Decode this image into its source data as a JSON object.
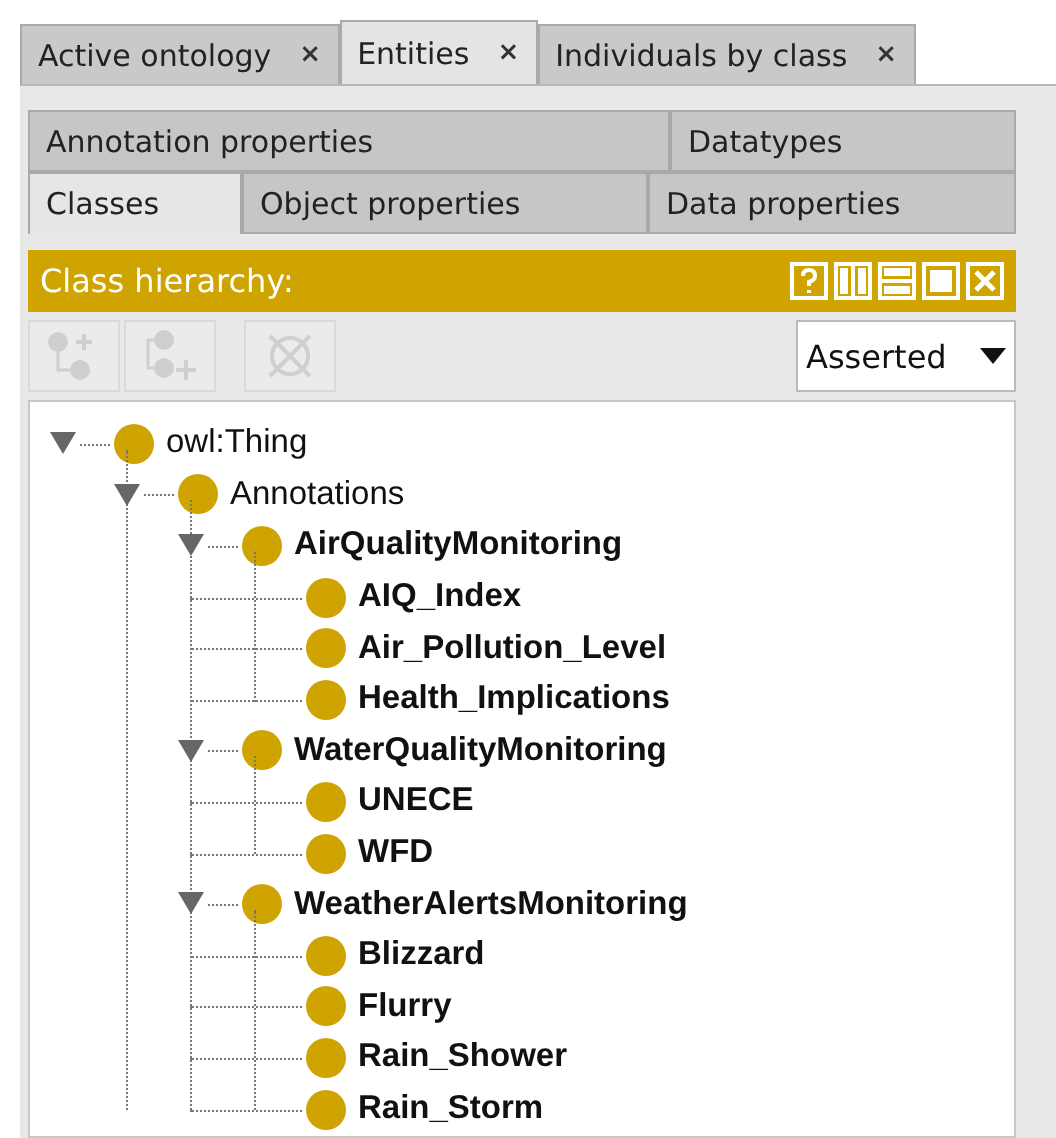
{
  "tabs": [
    {
      "label": "Active ontology",
      "close": "×",
      "selected": false
    },
    {
      "label": "Entities",
      "close": "×",
      "selected": true
    },
    {
      "label": "Individuals by class",
      "close": "×",
      "selected": false
    }
  ],
  "entity_tabs": [
    [
      {
        "label": "Annotation properties",
        "selected": false
      },
      {
        "label": "Datatypes",
        "selected": false
      }
    ],
    [
      {
        "label": "Classes",
        "selected": true
      },
      {
        "label": "Object properties",
        "selected": false
      },
      {
        "label": "Data properties",
        "selected": false
      }
    ]
  ],
  "panel": {
    "title": "Class hierarchy:"
  },
  "toolbar": {
    "buttons": [
      {
        "kind": "add-subclass",
        "disabled": true
      },
      {
        "kind": "add-sibling",
        "disabled": true
      },
      {
        "kind": "delete",
        "disabled": true
      }
    ],
    "mode": "Asserted"
  },
  "tree": [
    {
      "label": "owl:Thing",
      "bold": false,
      "expanded": true,
      "children": [
        {
          "label": "Annotations",
          "bold": false,
          "expanded": true,
          "children": [
            {
              "label": "AirQualityMonitoring",
              "bold": true,
              "expanded": true,
              "children": [
                {
                  "label": "AIQ_Index",
                  "bold": true
                },
                {
                  "label": "Air_Pollution_Level",
                  "bold": true
                },
                {
                  "label": "Health_Implications",
                  "bold": true
                }
              ]
            },
            {
              "label": "WaterQualityMonitoring",
              "bold": true,
              "expanded": true,
              "children": [
                {
                  "label": "UNECE",
                  "bold": true
                },
                {
                  "label": "WFD",
                  "bold": true
                }
              ]
            },
            {
              "label": "WeatherAlertsMonitoring",
              "bold": true,
              "expanded": true,
              "children": [
                {
                  "label": "Blizzard",
                  "bold": true
                },
                {
                  "label": "Flurry",
                  "bold": true
                },
                {
                  "label": "Rain_Shower",
                  "bold": true
                },
                {
                  "label": "Rain_Storm",
                  "bold": true
                }
              ]
            }
          ]
        }
      ]
    }
  ]
}
